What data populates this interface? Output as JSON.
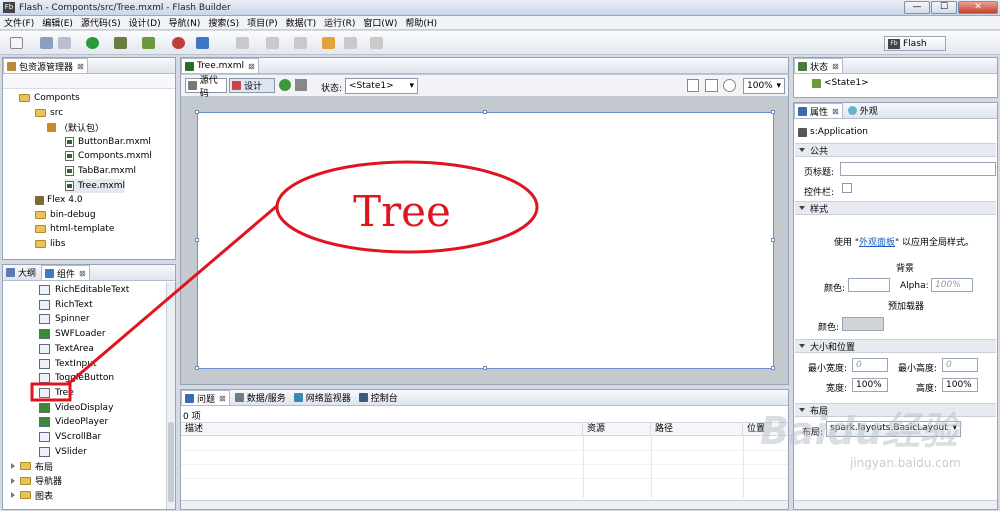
{
  "window": {
    "title": "Flash - Componts/src/Tree.mxml - Flash Builder",
    "app_badge": "Fb",
    "minimize": "—",
    "maximize": "☐",
    "close": "✕"
  },
  "menu": [
    "文件(F)",
    "编辑(E)",
    "源代码(S)",
    "设计(D)",
    "导航(N)",
    "搜索(S)",
    "项目(P)",
    "数据(T)",
    "运行(R)",
    "窗口(W)",
    "帮助(H)"
  ],
  "perspective": {
    "label": "Flash",
    "badge": "Fb"
  },
  "package_explorer": {
    "tab": "包资源管理器",
    "items": [
      {
        "label": "Componts",
        "type": "project"
      },
      {
        "label": "src",
        "type": "folder"
      },
      {
        "label": "（默认包）",
        "type": "package"
      },
      {
        "label": "ButtonBar.mxml",
        "type": "file"
      },
      {
        "label": "Componts.mxml",
        "type": "file"
      },
      {
        "label": "TabBar.mxml",
        "type": "file"
      },
      {
        "label": "Tree.mxml",
        "type": "file"
      },
      {
        "label": "Flex 4.0",
        "type": "library"
      },
      {
        "label": "bin-debug",
        "type": "folder"
      },
      {
        "label": "html-template",
        "type": "folder"
      },
      {
        "label": "libs",
        "type": "folder"
      }
    ]
  },
  "components_panel": {
    "tabs": [
      "大纲",
      "组件"
    ],
    "items": [
      "RichEditableText",
      "RichText",
      "Spinner",
      "SWFLoader",
      "TextArea",
      "TextInput",
      "ToggleButton",
      "Tree",
      "VideoDisplay",
      "VideoPlayer",
      "VScrollBar",
      "VSlider"
    ],
    "groups": [
      "布局",
      "导航器",
      "图表"
    ]
  },
  "editor": {
    "tab": "Tree.mxml",
    "source_btn": "源代码",
    "design_btn": "设计",
    "state_label": "状态:",
    "state_value": "<State1>",
    "zoom": "100%",
    "annotation": "Tree"
  },
  "problems_panel": {
    "tabs": [
      "问题",
      "数据/服务",
      "网络监视器",
      "控制台"
    ],
    "count": "0 项",
    "columns": [
      "描述",
      "资源",
      "路径",
      "位置"
    ]
  },
  "states_panel": {
    "tab": "状态",
    "state": "<State1>"
  },
  "properties_panel": {
    "tabs": [
      "属性",
      "外观"
    ],
    "component": "s:Application",
    "section_common": "公共",
    "page_title_label": "页标题:",
    "control_bar_label": "控件栏:",
    "section_style": "样式",
    "style_text_prefix": "使用 \"",
    "style_link": "外观面板",
    "style_text_suffix": "\" 以应用全局样式。",
    "background": "背景",
    "color_label": "颜色:",
    "alpha_label": "Alpha:",
    "alpha_value": "100%",
    "preloader": "预加载器",
    "preloader_color_label": "颜色:",
    "section_size": "大小和位置",
    "min_width_label": "最小宽度:",
    "min_width": "0",
    "min_height_label": "最小高度:",
    "min_height": "0",
    "width_label": "宽度:",
    "width": "100%",
    "height_label": "高度:",
    "height": "100%",
    "section_layout": "布局",
    "layout_label": "布局:",
    "layout_value": "spark.layouts.BasicLayout"
  },
  "watermark": {
    "brand": "Baidu经验",
    "url": "jingyan.baidu.com"
  }
}
